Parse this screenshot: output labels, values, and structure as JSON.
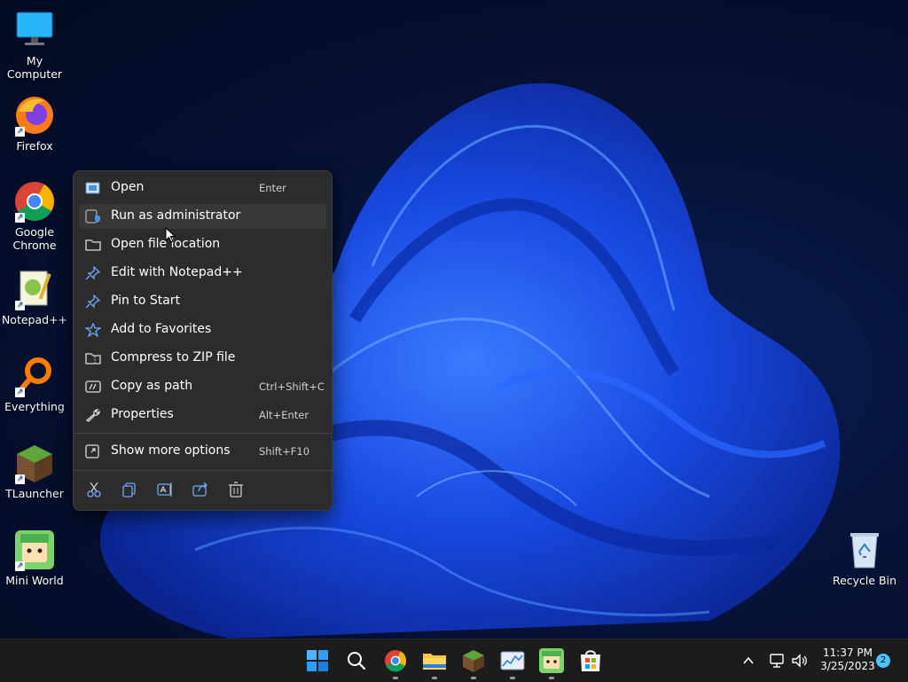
{
  "desktop": {
    "icons": [
      {
        "label": "My Computer",
        "icon": "monitor-icon"
      },
      {
        "label": "Firefox",
        "icon": "firefox-icon"
      },
      {
        "label": "Google Chrome",
        "icon": "chrome-icon"
      },
      {
        "label": "Notepad++",
        "icon": "notepadpp-icon"
      },
      {
        "label": "Everything",
        "icon": "everything-icon"
      },
      {
        "label": "TLauncher",
        "icon": "tlauncher-icon"
      },
      {
        "label": "Mini World",
        "icon": "miniworld-icon"
      }
    ],
    "recycle_bin": {
      "label": "Recycle Bin",
      "icon": "recycle-bin-icon"
    }
  },
  "context_menu": {
    "items": [
      {
        "label": "Open",
        "shortcut": "Enter",
        "icon": "open-icon"
      },
      {
        "label": "Run as administrator",
        "shortcut": "",
        "icon": "shield-icon"
      },
      {
        "label": "Open file location",
        "shortcut": "",
        "icon": "folder-icon"
      },
      {
        "label": "Edit with Notepad++",
        "shortcut": "",
        "icon": "pin-icon"
      },
      {
        "label": "Pin to Start",
        "shortcut": "",
        "icon": "pin-icon"
      },
      {
        "label": "Add to Favorites",
        "shortcut": "",
        "icon": "star-icon"
      },
      {
        "label": "Compress to ZIP file",
        "shortcut": "",
        "icon": "zip-icon"
      },
      {
        "label": "Copy as path",
        "shortcut": "Ctrl+Shift+C",
        "icon": "path-icon"
      },
      {
        "label": "Properties",
        "shortcut": "Alt+Enter",
        "icon": "wrench-icon"
      }
    ],
    "more": {
      "label": "Show more options",
      "shortcut": "Shift+F10",
      "icon": "more-options-icon"
    },
    "toolbar": [
      "cut-icon",
      "copy-icon",
      "rename-icon",
      "share-icon",
      "delete-icon"
    ]
  },
  "taskbar": {
    "apps": [
      "start-icon",
      "search-icon",
      "chrome-icon",
      "file-explorer-icon",
      "tlauncher-icon",
      "task-manager-icon",
      "miniworld-icon",
      "store-icon"
    ],
    "tray": [
      "chevron-up-icon",
      "network-icon",
      "volume-icon"
    ],
    "time": "11:37 PM",
    "date": "3/25/2023",
    "notification_count": "2"
  },
  "colors": {
    "accent": "#1a5cff",
    "menu_bg": "#2c2c2c",
    "taskbar_bg": "#1c1c1c"
  }
}
